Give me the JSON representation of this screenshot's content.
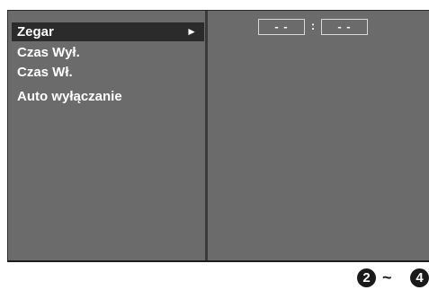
{
  "menu": {
    "items": [
      {
        "label": "Zegar",
        "selected": true,
        "arrow": "►"
      },
      {
        "label": "Czas Wył."
      },
      {
        "label": "Czas Wł."
      },
      {
        "label": "Auto wyłączanie"
      }
    ]
  },
  "clock": {
    "hours": "- -",
    "separator": ":",
    "minutes": "- -"
  },
  "page_ref": {
    "start": "2",
    "sep": "~",
    "end": "4"
  },
  "colors": {
    "osd_background": "#6b6b6b",
    "selected_background": "#2b2b2b",
    "text": "#ffffff"
  }
}
